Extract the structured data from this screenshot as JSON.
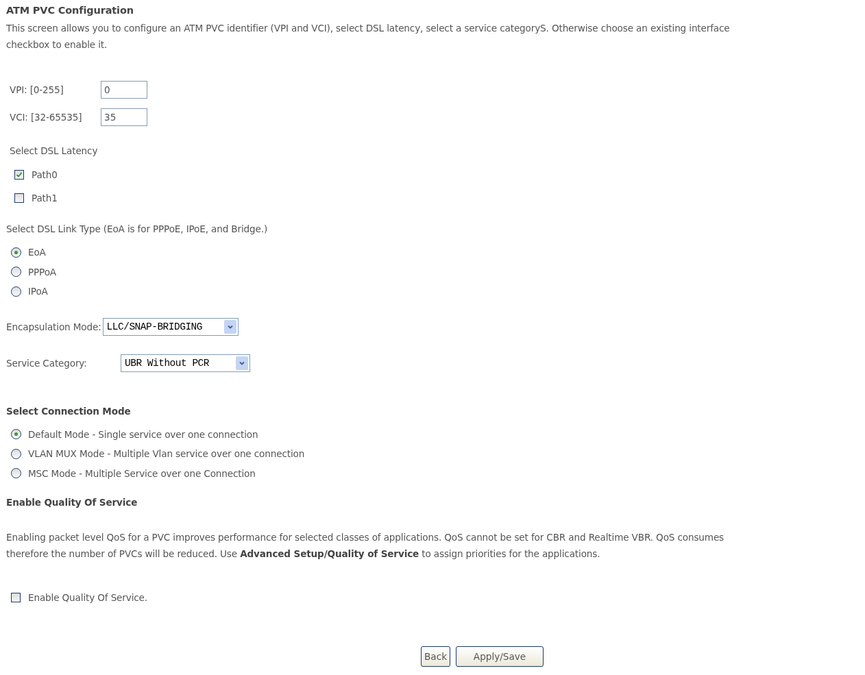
{
  "title": "ATM PVC Configuration",
  "intro_lines": [
    "This screen allows you to configure an ATM PVC identifier (VPI and VCI), select DSL latency, select a service categoryS. Otherwise choose an existing interface",
    "checkbox to enable it."
  ],
  "fields": [
    {
      "label": "VPI: [0-255]",
      "value": "0"
    },
    {
      "label": "VCI: [32-65535]",
      "value": "35"
    }
  ],
  "latency": {
    "label": "Select DSL Latency",
    "options": [
      {
        "label": "Path0",
        "checked": true
      },
      {
        "label": "Path1",
        "checked": false
      }
    ]
  },
  "link_type": {
    "label": "Select DSL Link Type (EoA is for PPPoE, IPoE, and Bridge.)",
    "options": [
      {
        "label": "EoA",
        "selected": true
      },
      {
        "label": "PPPoA",
        "selected": false
      },
      {
        "label": "IPoA",
        "selected": false
      }
    ]
  },
  "encapsulation": {
    "label": "Encapsulation Mode:",
    "value": "LLC/SNAP-BRIDGING"
  },
  "service_category": {
    "label": "Service Category:",
    "value": "UBR Without PCR"
  },
  "connection_mode": {
    "heading": "Select Connection Mode",
    "options": [
      {
        "label": "Default Mode - Single service over one connection",
        "selected": true
      },
      {
        "label": "VLAN MUX Mode - Multiple Vlan service over one connection",
        "selected": false
      },
      {
        "label": "MSC Mode - Multiple Service over one Connection",
        "selected": false
      }
    ]
  },
  "qos": {
    "heading": "Enable Quality Of Service",
    "lines": [
      "Enabling packet level QoS for a PVC improves performance for selected classes of applications.  QoS cannot be set for CBR and Realtime VBR.  QoS consumes",
      "therefore the number of PVCs will be reduced. Use **Advanced Setup/Quality of Service** to assign priorities for the applications."
    ],
    "checkbox": {
      "label": "Enable Quality Of Service.",
      "checked": false
    }
  },
  "buttons": [
    "Back",
    "Apply/Save"
  ]
}
